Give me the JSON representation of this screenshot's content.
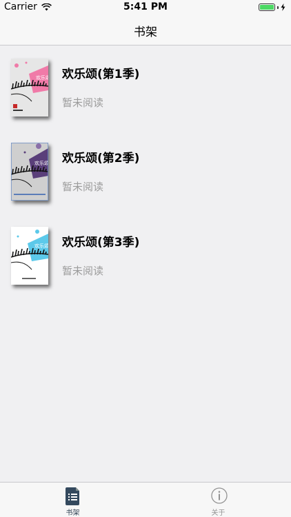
{
  "status_bar": {
    "carrier": "Carrier",
    "time": "5:41 PM",
    "battery_level": 1.0,
    "battery_color": "#4cd964"
  },
  "nav": {
    "title": "书架"
  },
  "books": [
    {
      "title": "欢乐颂(第1季)",
      "status": "暂未阅读",
      "cover_accent": "#f07aa8",
      "cover_base": "#e6e6e6",
      "cover_text": "欢乐颂"
    },
    {
      "title": "欢乐颂(第2季)",
      "status": "暂未阅读",
      "cover_accent": "#5a3f7a",
      "cover_base": "#cfcfcf",
      "cover_text": "欢乐颂"
    },
    {
      "title": "欢乐颂(第3季)",
      "status": "暂未阅读",
      "cover_accent": "#5cc9ea",
      "cover_base": "#ffffff",
      "cover_text": "欢乐颂"
    }
  ],
  "tabs": [
    {
      "label": "书架",
      "icon": "book-icon",
      "selected": true
    },
    {
      "label": "关于",
      "icon": "info-icon",
      "selected": false
    }
  ]
}
